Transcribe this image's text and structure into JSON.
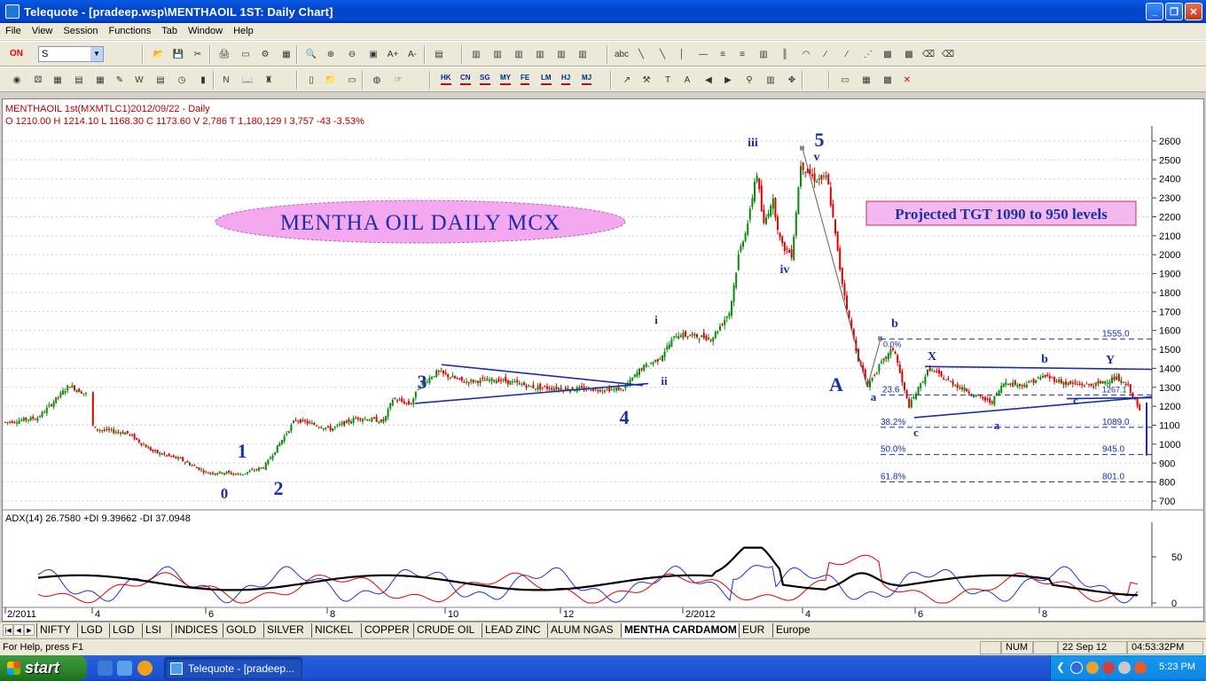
{
  "window": {
    "title": "Telequote - [pradeep.wsp\\MENTHAOIL 1ST: Daily Chart]"
  },
  "menu": [
    "File",
    "View",
    "Session",
    "Functions",
    "Tab",
    "Window",
    "Help"
  ],
  "toolbar": {
    "on_label": "ON",
    "symbol_value": "S",
    "market_codes": [
      "HK",
      "CN",
      "SG",
      "MY",
      "FE",
      "LM",
      "HJ",
      "MJ"
    ]
  },
  "chart": {
    "header_line1": "MENTHAOIL 1st(MXMTLC1)2012/09/22  - Daily",
    "header_line2": "O 1210.00 H 1214.10 L 1168.30 C 1173.60 V 2,786 T 1,180,129 I 3,757  -43  -3.53%",
    "banner_title": "MENTHA  OIL  DAILY  MCX",
    "projection_box": "Projected TGT 1090 to 950 levels",
    "indicator_header": "ADX(14)  26.7580   +DI  9.39662  -DI  37.0948",
    "colors": {
      "up": "#0a8a0a",
      "down": "#dd0000",
      "wave_label": "#1a2fa8",
      "header": "#b00000",
      "adx": "#000000",
      "plus_di": "#2233cc",
      "minus_di": "#dd0000"
    }
  },
  "chart_data": {
    "type": "candlestick",
    "series": [
      {
        "name": "MENTHAOIL 1st(MXMTLC1)"
      }
    ],
    "ylim": [
      650,
      2700
    ],
    "y_ticks": [
      "2600",
      "2500",
      "2400",
      "2300",
      "2200",
      "2100",
      "2000",
      "1900",
      "1800",
      "1700",
      "1600",
      "1500",
      "1400",
      "1300",
      "1200",
      "1100",
      "1000",
      "900",
      "800",
      "700"
    ],
    "x_ticks": [
      "2/2011",
      "4",
      "6",
      "8",
      "10",
      "12",
      "2/2012",
      "4",
      "6",
      "8"
    ],
    "close_path": [
      [
        "2/2011",
        1120
      ],
      [
        "3/2011",
        1300
      ],
      [
        "4/2011",
        1060
      ],
      [
        "5/2011",
        940
      ],
      [
        "6/2011",
        830
      ],
      [
        "7/2011",
        1150
      ],
      [
        "8/2011",
        1080
      ],
      [
        "9/2011",
        1240
      ],
      [
        "10/2011",
        1370
      ],
      [
        "11/2011",
        1320
      ],
      [
        "12/2011",
        1300
      ],
      [
        "1/2012",
        1550
      ],
      [
        "2/2012",
        1600
      ],
      [
        "3/2012",
        2520
      ],
      [
        "4/2012",
        2520
      ],
      [
        "5/2012",
        1310
      ],
      [
        "6/2012",
        1390
      ],
      [
        "7/2012",
        1180
      ],
      [
        "8/2012",
        1380
      ],
      [
        "9/2012",
        1173.6
      ]
    ],
    "wave_labels": [
      "0",
      "1",
      "2",
      "3",
      "4",
      "i",
      "ii",
      "iii",
      "iv",
      "v",
      "5",
      "A",
      "a",
      "b",
      "c",
      "X",
      "a",
      "b",
      "c",
      "Y"
    ],
    "fib_levels": [
      {
        "label": "23.6",
        "level": 1260
      },
      {
        "label": "38.2%",
        "level": 1089.0,
        "value_label": "1089.0"
      },
      {
        "label": "50.0%",
        "level": 945.0,
        "value_label": "945.0"
      },
      {
        "label": "61.8%",
        "level": 801.0,
        "value_label": "801.0"
      },
      {
        "label": "",
        "level": 1555.0,
        "value_label": "1555.0"
      }
    ],
    "indicator": {
      "name": "ADX(14)",
      "y_ticks": [
        "50",
        "0"
      ],
      "adx": 26.758,
      "plus_di": 9.39662,
      "minus_di": 37.0948
    }
  },
  "sheets": [
    "NIFTY",
    "LGD",
    "LGD",
    "LSI",
    "INDICES",
    "GOLD",
    "SILVER",
    "NICKEL",
    "COPPER",
    "CRUDE OIL",
    "LEAD ZINC",
    "ALUM NGAS",
    "MENTHA CARDAMOM",
    "EUR",
    "Europe"
  ],
  "active_sheet": "MENTHA CARDAMOM",
  "status": {
    "help": "For Help, press F1",
    "num": "NUM",
    "date": "22 Sep 12",
    "time": "04:53:32PM"
  },
  "taskbar": {
    "start": "start",
    "task": "Telequote - [pradeep...",
    "clock": "5:23 PM"
  }
}
